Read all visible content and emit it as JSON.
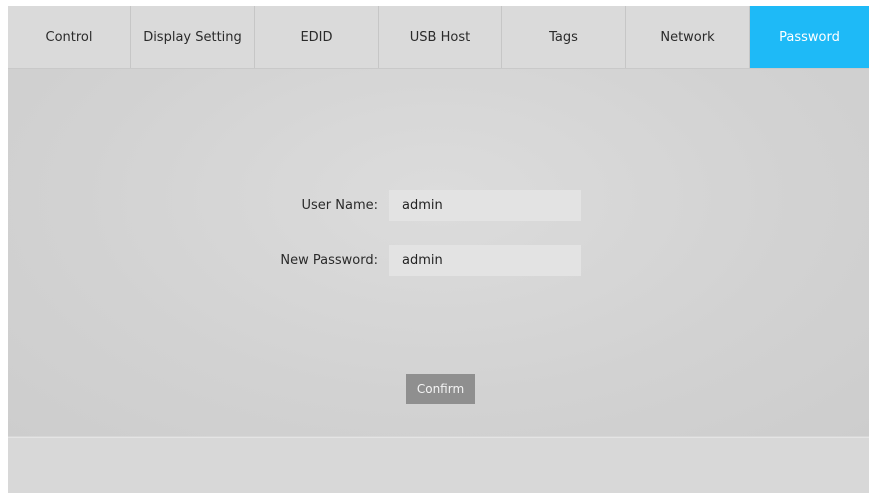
{
  "tabs": [
    {
      "label": "Control",
      "active": false
    },
    {
      "label": "Display Setting",
      "active": false
    },
    {
      "label": "EDID",
      "active": false
    },
    {
      "label": "USB Host",
      "active": false
    },
    {
      "label": "Tags",
      "active": false
    },
    {
      "label": "Network",
      "active": false
    },
    {
      "label": "Password",
      "active": true
    }
  ],
  "form": {
    "username_label": "User Name:",
    "username_value": "admin",
    "password_label": "New Password:",
    "password_value": "admin",
    "confirm_label": "Confirm"
  },
  "colors": {
    "accent": "#1ebaf7",
    "button": "#8f8f8f"
  }
}
